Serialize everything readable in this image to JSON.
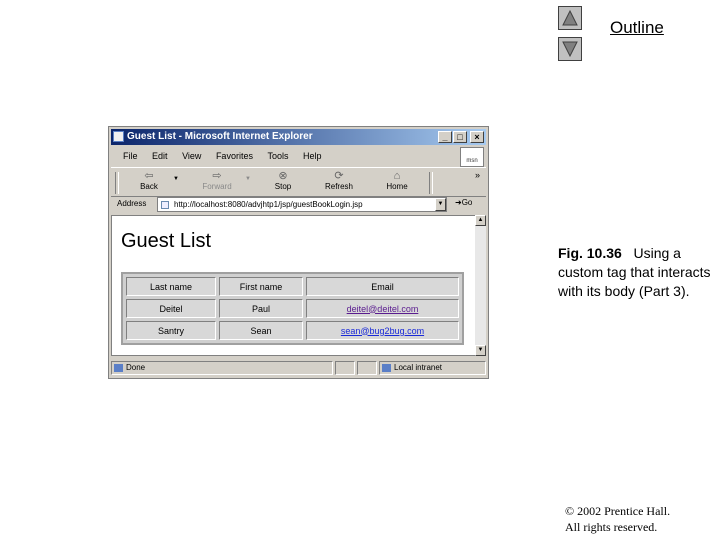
{
  "slide": {
    "outline_label": "Outline",
    "caption_bold": "Fig. 10.36",
    "caption_text": "Using a custom tag that interacts with its body (Part 3).",
    "copyright_line1": "© 2002 Prentice Hall.",
    "copyright_line2": "All rights reserved."
  },
  "browser": {
    "window_title": "Guest List - Microsoft Internet Explorer",
    "menu": [
      "File",
      "Edit",
      "View",
      "Favorites",
      "Tools",
      "Help"
    ],
    "toolbar": {
      "back": "Back",
      "forward": "Forward",
      "stop": "Stop",
      "refresh": "Refresh",
      "home": "Home"
    },
    "address_label": "Address",
    "address_url": "http://localhost:8080/advjhtp1/jsp/guestBookLogin.jsp",
    "go_label": "Go",
    "status": {
      "done": "Done",
      "zone": "Local intranet"
    }
  },
  "page": {
    "heading": "Guest List",
    "columns": [
      "Last name",
      "First name",
      "Email"
    ],
    "rows": [
      {
        "last": "Deitel",
        "first": "Paul",
        "email": "deitel@deitel.com"
      },
      {
        "last": "Santry",
        "first": "Sean",
        "email": "sean@bug2bug.com"
      }
    ]
  },
  "colors": {
    "titlebar_start": "#0a246a",
    "visited_link": "#5a1c8f",
    "link": "#1a2ad8"
  }
}
